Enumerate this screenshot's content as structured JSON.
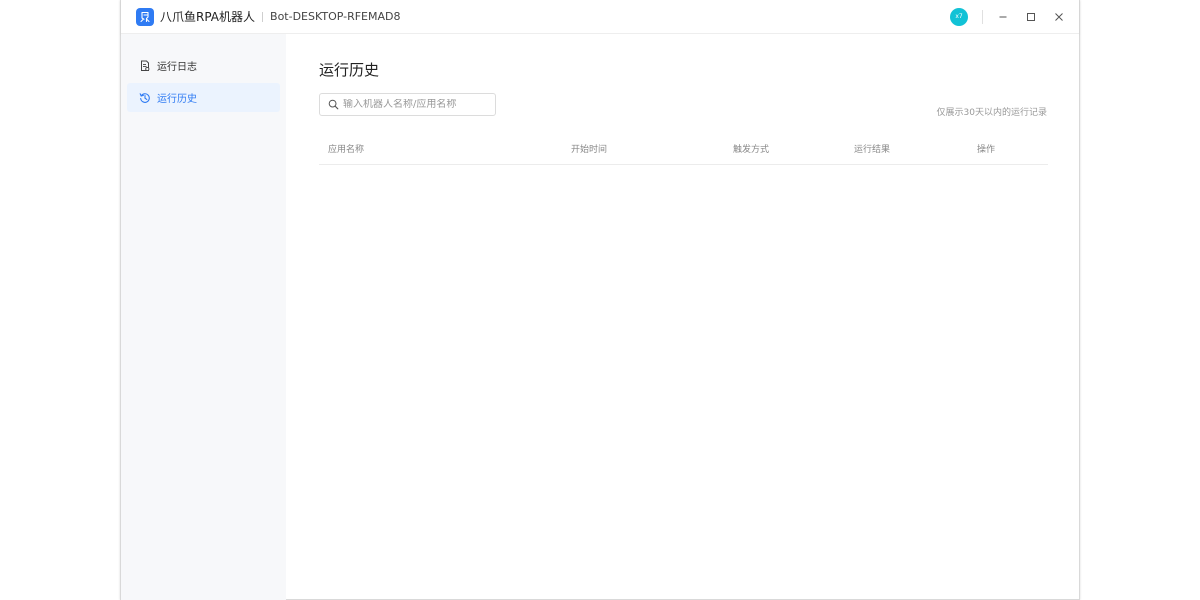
{
  "titlebar": {
    "app_name": "八爪鱼RPA机器人",
    "bot_name": "Bot-DESKTOP-RFEMAD8",
    "avatar_text": "x7",
    "logo_color": "#2f7bf3",
    "avatar_color": "#12c2d6"
  },
  "sidebar": {
    "items": [
      {
        "label": "运行日志",
        "icon": "document-icon",
        "active": false
      },
      {
        "label": "运行历史",
        "icon": "history-icon",
        "active": true
      }
    ]
  },
  "main": {
    "title": "运行历史",
    "search": {
      "placeholder": "输入机器人名称/应用名称",
      "value": ""
    },
    "note": "仅展示30天以内的运行记录",
    "table": {
      "columns": [
        "应用名称",
        "开始时间",
        "触发方式",
        "运行结果",
        "操作"
      ],
      "rows": []
    }
  },
  "colors": {
    "accent": "#2f7bf3",
    "active_bg": "#ebf3fe",
    "sidebar_bg": "#f7f8fa"
  }
}
